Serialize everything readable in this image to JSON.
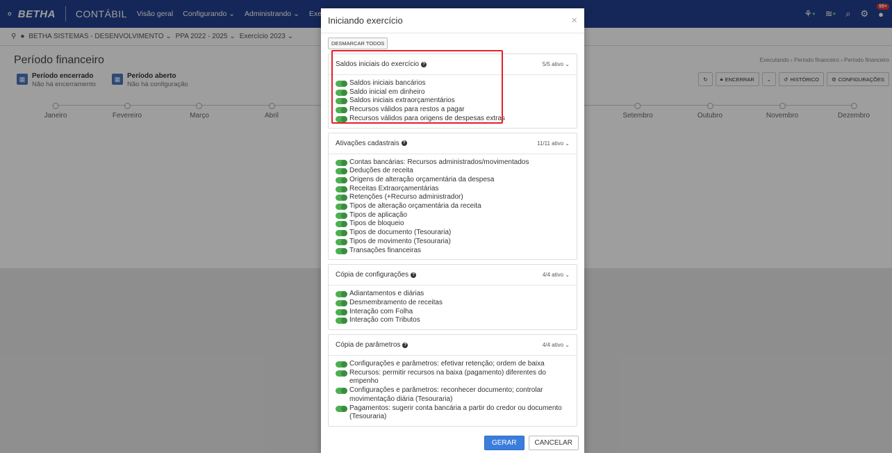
{
  "topnav": {
    "logo": "BETHA",
    "app": "CONTÁBIL",
    "menu": [
      "Visão geral",
      "Configurando ⌄",
      "Administrando ⌄",
      "Executando ⌄"
    ],
    "notif_count": "99+"
  },
  "context": {
    "entity": "BETHA SISTEMAS - DESENVOLVIMENTO ⌄",
    "ppa": "PPA 2022 - 2025 ⌄",
    "exercise": "Exercício 2023 ⌄"
  },
  "page": {
    "title": "Período financeiro",
    "breadcrumb": "Executando › Período financeiro › Período financeiro",
    "closed_title": "Período encerrado",
    "closed_sub": "Não há encerramento",
    "open_title": "Período aberto",
    "open_sub": "Não há configuração",
    "toolbar": {
      "encerrar": "ENCERRAR",
      "historico": "HISTÓRICO",
      "configuracoes": "CONFIGURAÇÕES"
    },
    "months": [
      "Janeiro",
      "Fevereiro",
      "Março",
      "Abril",
      "Setembro",
      "Outubro",
      "Novembro",
      "Dezembro"
    ]
  },
  "modal": {
    "title": "Iniciando exercício",
    "deselect_all": "DESMARCAR TODOS",
    "sections": [
      {
        "title": "Saldos iniciais do exercício",
        "count": "5/5 ativo ⌄",
        "items": [
          "Saldos iniciais bancários",
          "Saldo inicial em dinheiro",
          "Saldos iniciais extraorçamentários",
          "Recursos válidos para restos a pagar",
          "Recursos válidos para origens de despesas extras"
        ]
      },
      {
        "title": "Ativações cadastrais",
        "count": "11/11 ativo ⌄",
        "items": [
          "Contas bancárias: Recursos administrados/movimentados",
          "Deduções de receita",
          "Origens de alteração orçamentária da despesa",
          "Receitas Extraorçamentárias",
          "Retenções (+Recurso administrador)",
          "Tipos de alteração orçamentária da receita",
          "Tipos de aplicação",
          "Tipos de bloqueio",
          "Tipos de documento (Tesouraria)",
          "Tipos de movimento (Tesouraria)",
          "Transações financeiras"
        ]
      },
      {
        "title": "Cópia de configurações",
        "count": "4/4 ativo ⌄",
        "items": [
          "Adiantamentos e diárias",
          "Desmembramento de receitas",
          "Interação com Folha",
          "Interação com Tributos"
        ]
      },
      {
        "title": "Cópia de parâmetros",
        "count": "4/4 ativo ⌄",
        "items": [
          "Configurações e parâmetros: efetivar retenção; ordem de baixa",
          "Recursos: permitir recursos na baixa (pagamento) diferentes do empenho",
          "Configurações e parâmetros: reconhecer documento; controlar movimentação diária (Tesouraria)",
          "Pagamentos: sugerir conta bancária a partir do credor ou documento (Tesouraria)"
        ]
      }
    ],
    "footer": {
      "generate": "GERAR",
      "cancel": "CANCELAR"
    }
  },
  "colors": {
    "nav": "#23408e",
    "toggle_on": "#4caf50",
    "primary": "#3b7ddd",
    "highlight": "#e41e26"
  }
}
